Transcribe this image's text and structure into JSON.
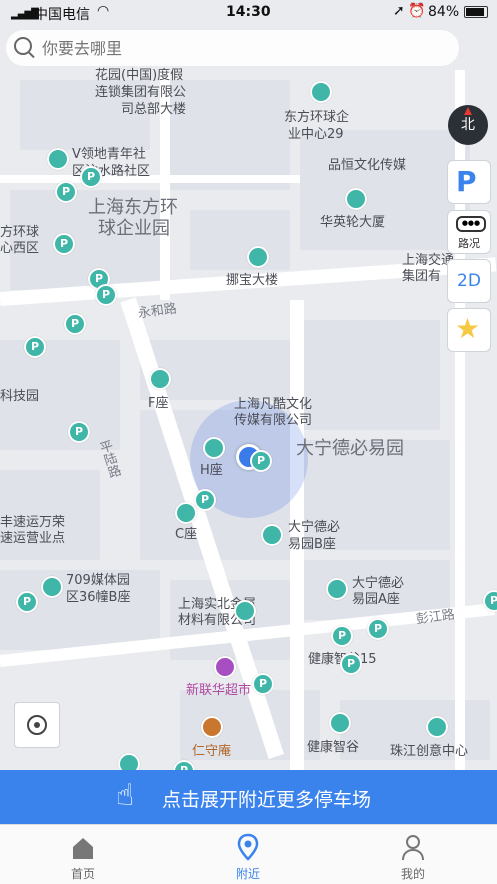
{
  "status_bar": {
    "carrier": "中国电信",
    "time": "14:30",
    "battery": "84%"
  },
  "search": {
    "placeholder": "你要去哪里"
  },
  "map_labels": {
    "l1": "花园(中国)度假",
    "l2": "连锁集团有限公",
    "l3": "司总部大楼",
    "l4": "东方环球企",
    "l5": "业中心29",
    "l6": "V领地青年社",
    "l7": "区汶水路社区",
    "l8": "品恒文化传媒",
    "l9": "上海东方环",
    "l10": "球企业园",
    "l11": "华英轮大厦",
    "l12": "方环球",
    "l13": "心西区",
    "l14": "挪宝大楼",
    "l15": "上海交通",
    "l16": "集团有",
    "l17": "永和路",
    "l18": "科技园",
    "l19": "F座",
    "l20": "上海凡酷文化",
    "l21": "传媒有限公司",
    "l22": "大宁德必易园",
    "l23": "平陆路",
    "l24": "H座",
    "l25": "丰速运万荣",
    "l26": "速运营业点",
    "l27": "C座",
    "l28": "大宁德必",
    "l29": "易园B座",
    "l30": "709媒体园",
    "l31": "区36幢B座",
    "l32": "大宁德必",
    "l33": "易园A座",
    "l34": "上海实北金属",
    "l35": "材料有限公司",
    "l36": "彭江路",
    "l37": "健康智谷15",
    "l38": "新联华超市",
    "l39": "仁守庵",
    "l40": "健康智谷",
    "l41": "珠江创意中心"
  },
  "controls": {
    "compass": "北",
    "traffic": "路况",
    "mode_2d": "2D"
  },
  "banner": {
    "text": "点击展开附近更多停车场"
  },
  "tabs": [
    {
      "label": "首页",
      "icon": "home-icon"
    },
    {
      "label": "附近",
      "icon": "location-pin-icon"
    },
    {
      "label": "我的",
      "icon": "user-icon"
    }
  ],
  "colors": {
    "accent": "#3a83ed",
    "poi": "#3fb6a8",
    "active_tab": "#3a83ed"
  }
}
